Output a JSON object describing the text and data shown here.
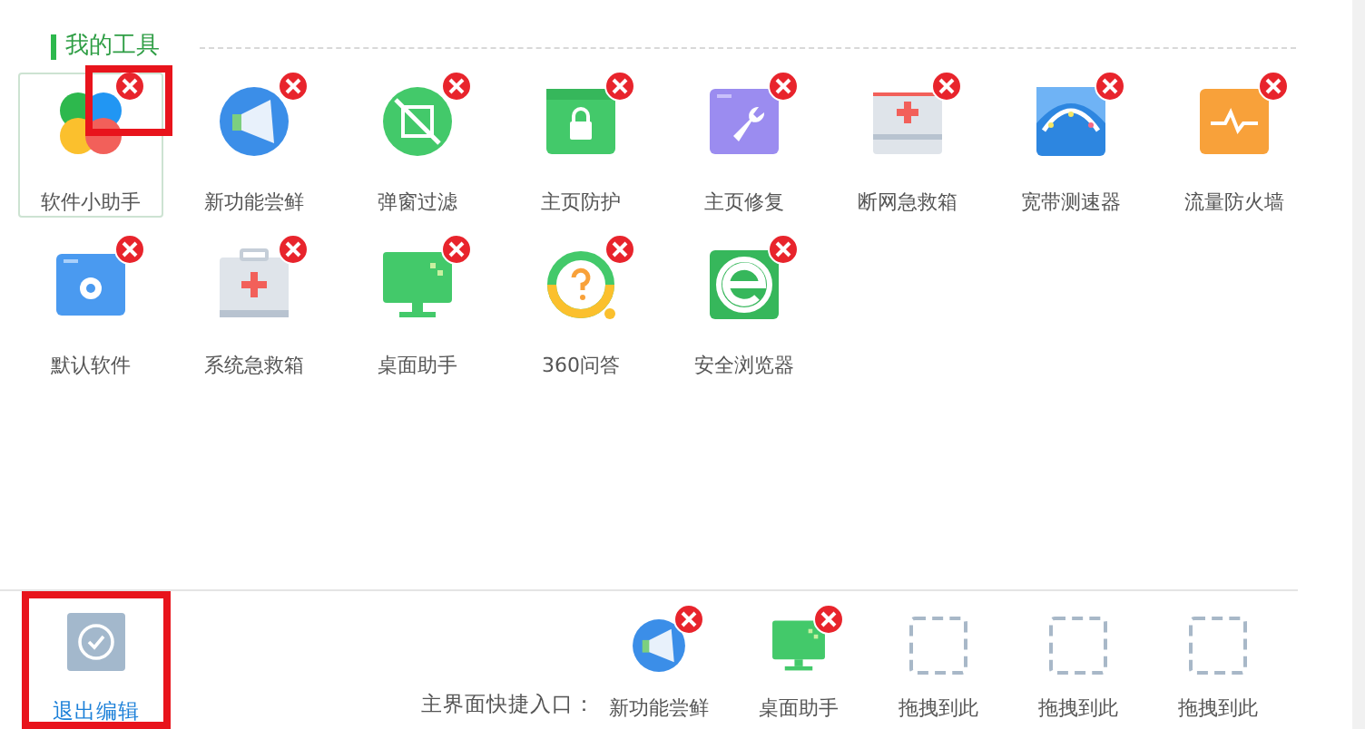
{
  "section": {
    "title": "我的工具"
  },
  "tools": [
    {
      "label": "软件小助手",
      "selected": true,
      "highlighted": true
    },
    {
      "label": "新功能尝鲜",
      "selected": false,
      "highlighted": false
    },
    {
      "label": "弹窗过滤",
      "selected": false,
      "highlighted": false
    },
    {
      "label": "主页防护",
      "selected": false,
      "highlighted": false
    },
    {
      "label": "主页修复",
      "selected": false,
      "highlighted": false
    },
    {
      "label": "断网急救箱",
      "selected": false,
      "highlighted": false
    },
    {
      "label": "宽带测速器",
      "selected": false,
      "highlighted": false
    },
    {
      "label": "流量防火墙",
      "selected": false,
      "highlighted": false
    },
    {
      "label": "默认软件",
      "selected": false,
      "highlighted": false
    },
    {
      "label": "系统急救箱",
      "selected": false,
      "highlighted": false
    },
    {
      "label": "桌面助手",
      "selected": false,
      "highlighted": false
    },
    {
      "label": "360问答",
      "selected": false,
      "highlighted": false
    },
    {
      "label": "安全浏览器",
      "selected": false,
      "highlighted": false
    }
  ],
  "exit_button": {
    "label": "退出编辑",
    "highlighted": true
  },
  "shortcuts": {
    "label": "主界面快捷入口：",
    "items": [
      {
        "kind": "tool",
        "label": "新功能尝鲜"
      },
      {
        "kind": "tool",
        "label": "桌面助手"
      },
      {
        "kind": "slot",
        "label": "拖拽到此"
      },
      {
        "kind": "slot",
        "label": "拖拽到此"
      },
      {
        "kind": "slot",
        "label": "拖拽到此"
      }
    ]
  }
}
